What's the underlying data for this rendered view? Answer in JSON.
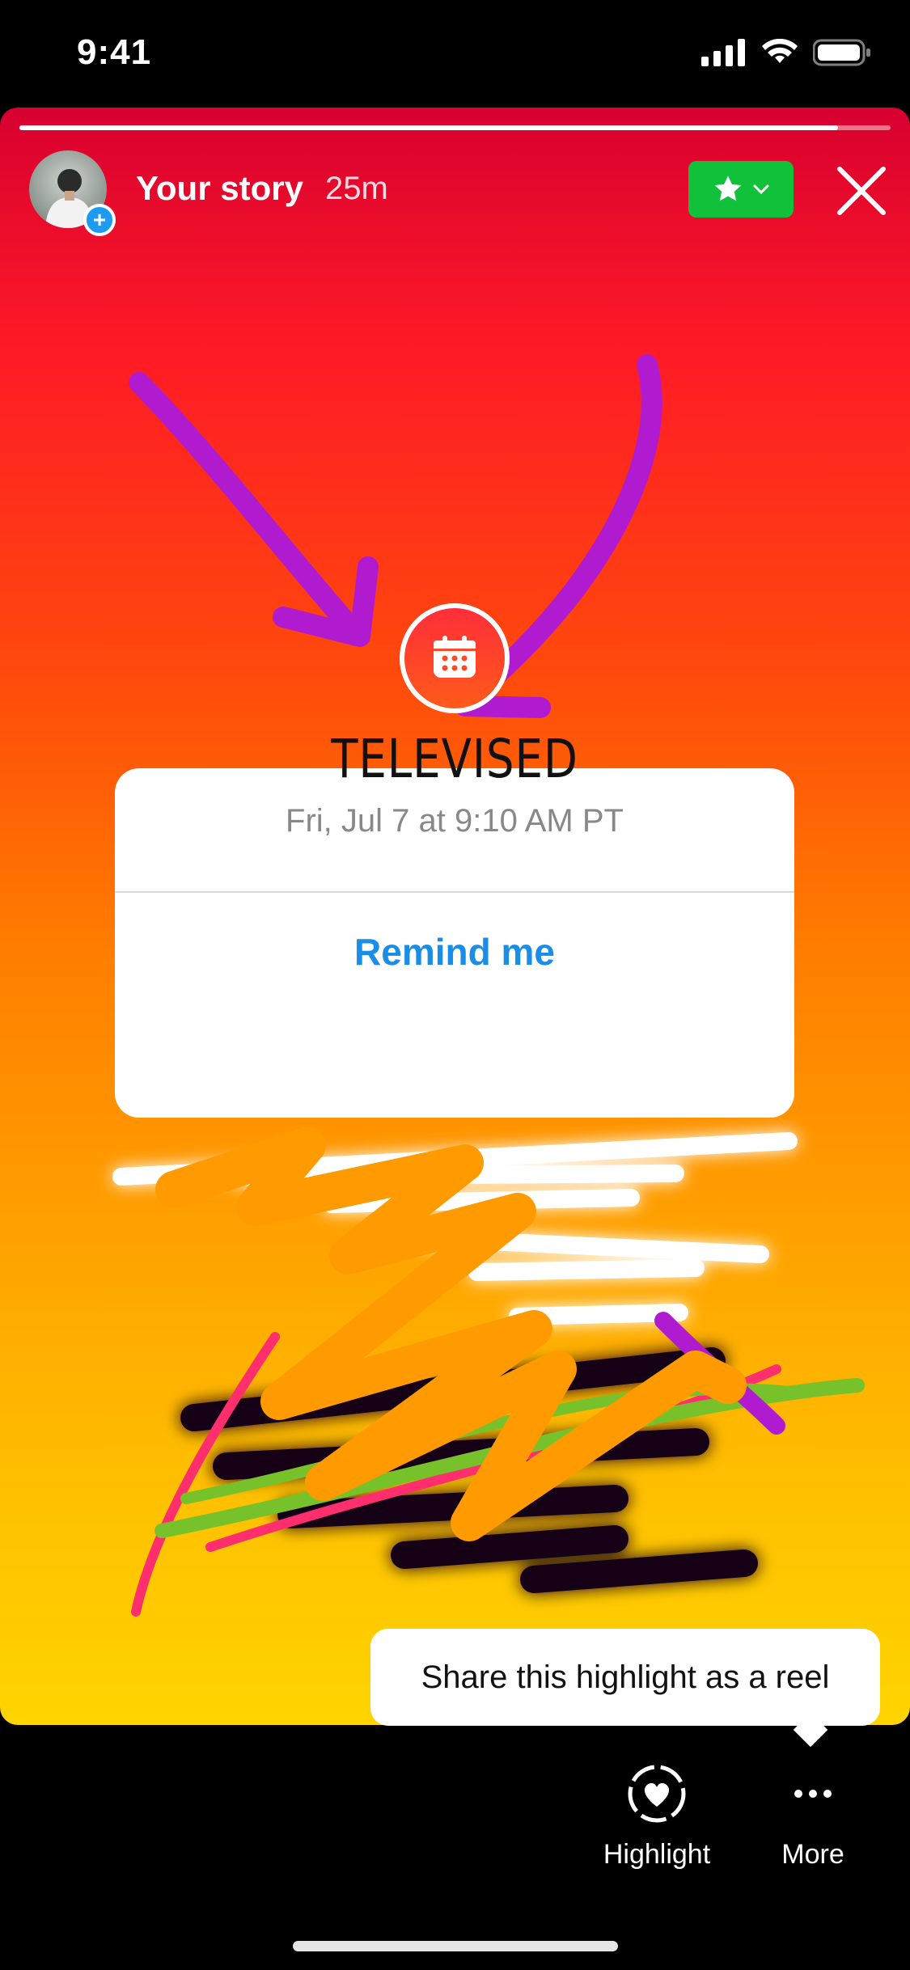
{
  "status_bar": {
    "time": "9:41"
  },
  "story": {
    "title": "Your story",
    "time_ago": "25m",
    "progress": 0.94
  },
  "sticker": {
    "title": "TELEVISED",
    "date": "Fri, Jul 7 at 9:10 AM PT",
    "action_label": "Remind me"
  },
  "tooltip": {
    "text": "Share this highlight as a reel"
  },
  "bottom_actions": [
    {
      "label": "Highlight",
      "icon": "highlight-heart-icon"
    },
    {
      "label": "More",
      "icon": "more-dots-icon"
    }
  ],
  "colors": {
    "close_friends_green": "#12c13a",
    "remind_blue": "#1a8ee6",
    "doodle_purple": "#b11bd0",
    "doodle_orange": "#ff9a00"
  }
}
